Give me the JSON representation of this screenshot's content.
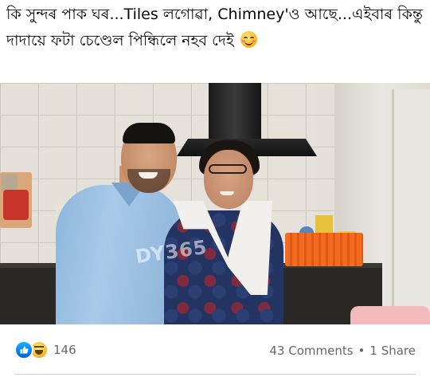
{
  "post": {
    "text": "কি সুন্দৰ পাক ঘৰ...Tiles লগোৱা, Chimney'ও আছে...এইবাৰ কিন্তু দাদায়ে ফটা চেণ্ডেল পিন্ধিলে নহব দেই",
    "emoji": "smiling-blushing-emoji"
  },
  "photo": {
    "watermark": "DY365"
  },
  "footer": {
    "reaction_icons": [
      "like-icon",
      "haha-icon"
    ],
    "reaction_count": "146",
    "comments": "43 Comments",
    "separator": "•",
    "shares": "1 Share"
  },
  "colors": {
    "like_blue": "#1877f2",
    "meta_text": "#65676b",
    "text": "#050505"
  }
}
